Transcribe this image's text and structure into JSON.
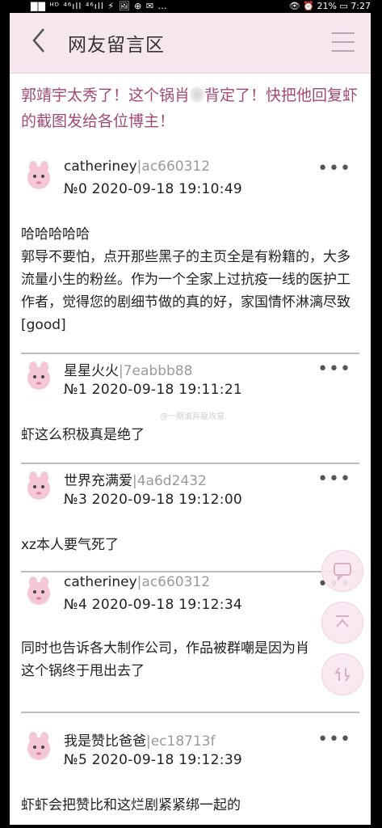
{
  "status_bar": {
    "left": "▇▇ ᴴᴰ ⁴⁶ıll ⁴⁶ıll ⚡ 🖼 ⊕ ✉ …",
    "right": "👁 ⏰ 21% ▭ 7:27"
  },
  "header": {
    "title": "网友留言区"
  },
  "topic": {
    "text_part1": "郭靖宇太秀了！这个锅肖",
    "text_part2": "背定了！快把他回复虾的截图发给各位博主！"
  },
  "watermark": "@一期谁弃疲攻意",
  "comments": [
    {
      "username": "catheriney",
      "uid": "|ac660312",
      "meta": "№0  2020-09-18 19:10:49",
      "lines": [
        "哈哈哈哈哈",
        "郭导不要怕，点开那些黑子的主页全是有粉籍的，大多流量小生的粉丝。作为一个全家上过抗疫一线的医护工作者，觉得您的剧细节做的真的好，家国情怀淋漓尽致[good]"
      ]
    },
    {
      "username": "星星火火",
      "uid": "|7eabbb88",
      "meta": "№1  2020-09-18 19:11:21",
      "lines": [
        "虾这么积极真是绝了"
      ]
    },
    {
      "username": "世界充满爱",
      "uid": "|4a6d2432",
      "meta": "№3  2020-09-18 19:12:00",
      "lines": [
        "xz本人要气死了"
      ]
    },
    {
      "username": "catheriney",
      "uid": "|ac660312",
      "meta": "№4  2020-09-18 19:12:34",
      "lines": [
        "同时也告诉各大制作公司，作品被群嘲是因为肖",
        "这个锅终于甩出去了"
      ]
    },
    {
      "username": "我是赞比爸爸",
      "uid": "|ec18713f",
      "meta": "№5  2020-09-18 19:12:39",
      "lines": [
        "虾虾会把赞比和这烂剧紧紧绑一起的"
      ]
    }
  ],
  "more_label": "•••",
  "colors": {
    "header_bg": "#f6e7ee",
    "topic": "#a24a76",
    "uid": "#9a9a9a"
  }
}
